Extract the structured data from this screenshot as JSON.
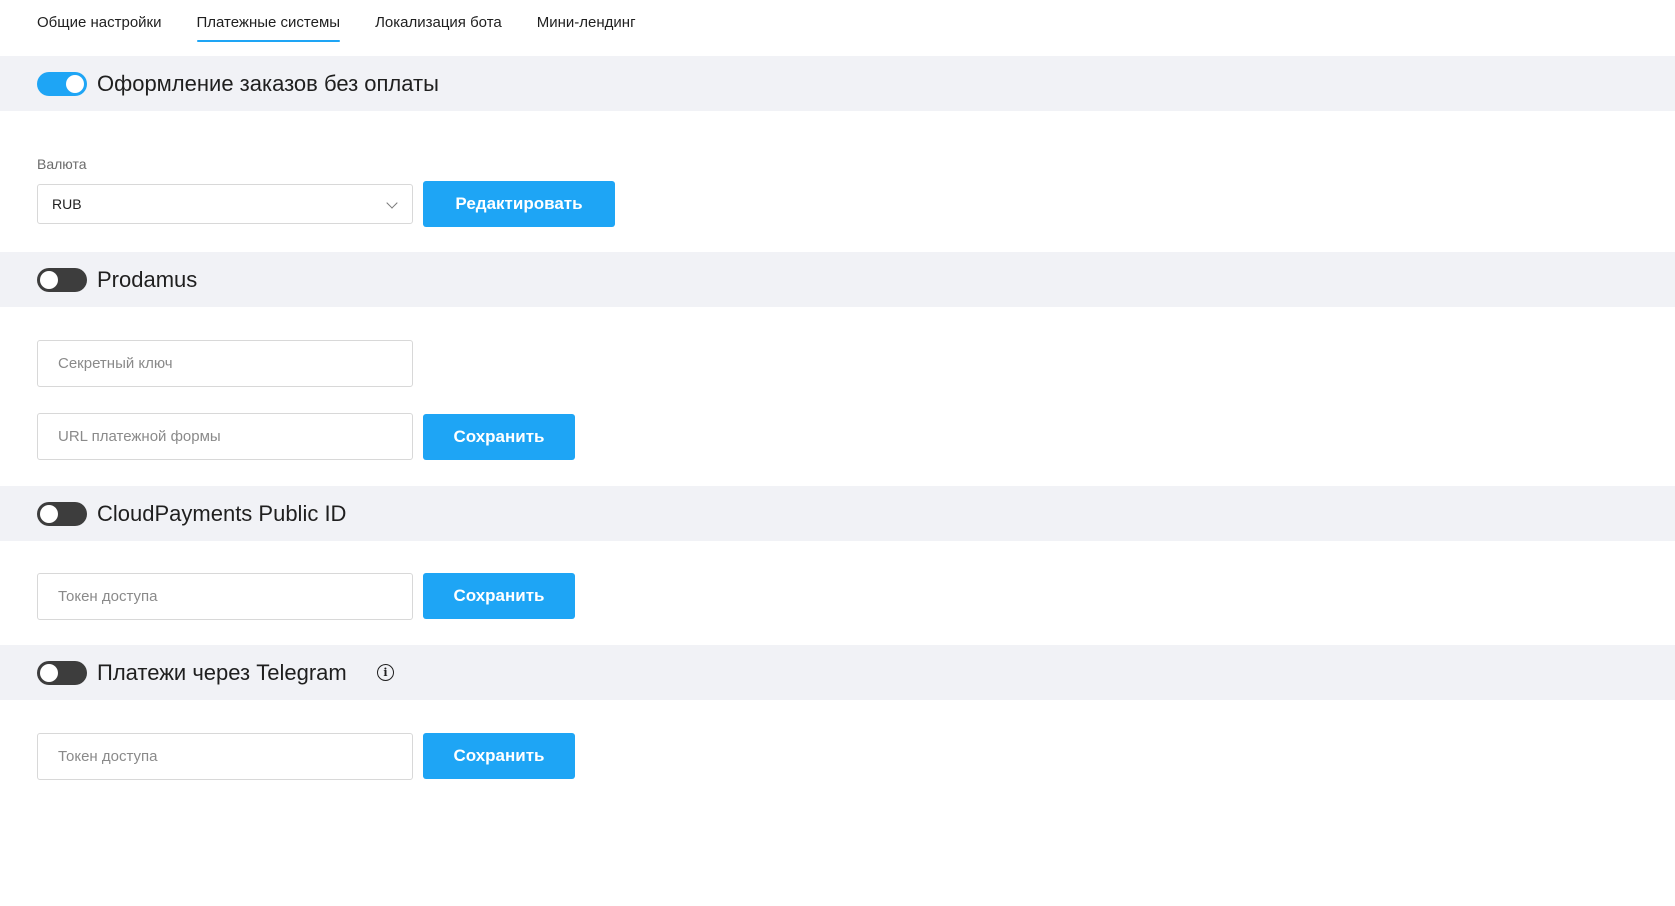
{
  "tabs": [
    {
      "label": "Общие настройки",
      "active": false
    },
    {
      "label": "Платежные системы",
      "active": true
    },
    {
      "label": "Локализация бота",
      "active": false
    },
    {
      "label": "Мини-лендинг",
      "active": false
    }
  ],
  "sections": {
    "no_payment": {
      "title": "Оформление заказов без оплаты",
      "enabled": true,
      "currency_label": "Валюта",
      "currency_value": "RUB",
      "edit_button": "Редактировать"
    },
    "prodamus": {
      "title": "Prodamus",
      "enabled": false,
      "secret_key_placeholder": "Секретный ключ",
      "form_url_placeholder": "URL платежной формы",
      "save_button": "Сохранить"
    },
    "cloudpayments": {
      "title": "CloudPayments Public ID",
      "enabled": false,
      "token_placeholder": "Токен доступа",
      "save_button": "Сохранить"
    },
    "telegram": {
      "title": "Платежи через Telegram",
      "enabled": false,
      "info_icon": "info-icon",
      "token_placeholder": "Токен доступа",
      "save_button": "Сохранить"
    }
  },
  "colors": {
    "accent": "#1ea5f5",
    "toggle_off": "#3d3d3d",
    "section_bg": "#f1f2f6"
  }
}
